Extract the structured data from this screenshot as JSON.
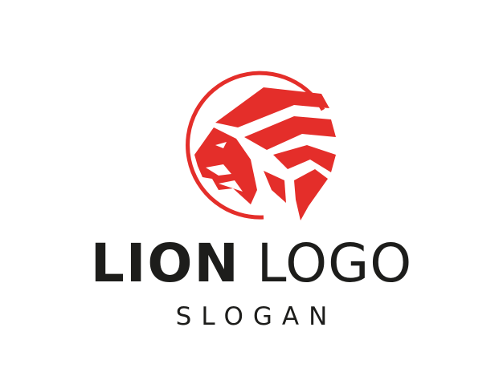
{
  "logo": {
    "title_part1": "LION",
    "title_part2": "LOGO",
    "slogan": "SLOGAN",
    "emblem_icon": "lion-head-icon",
    "colors": {
      "accent": "#e42e2a",
      "text": "#1d1d1b",
      "background": "#ffffff"
    }
  }
}
